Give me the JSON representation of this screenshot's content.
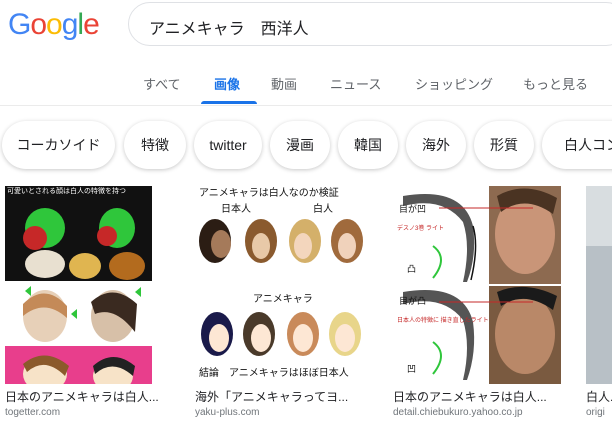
{
  "logo": {
    "letters": [
      "G",
      "o",
      "o",
      "g",
      "l",
      "e"
    ],
    "colors": [
      "#4285F4",
      "#EA4335",
      "#FBBC05",
      "#4285F4",
      "#34A853",
      "#EA4335"
    ]
  },
  "search": {
    "query": "アニメキャラ　西洋人"
  },
  "tabs": [
    {
      "label": "すべて"
    },
    {
      "label": "画像"
    },
    {
      "label": "動画"
    },
    {
      "label": "ニュース"
    },
    {
      "label": "ショッピング"
    },
    {
      "label": "もっと見る"
    }
  ],
  "chips": [
    "コーカソイド",
    "特徴",
    "twitter",
    "漫画",
    "韓国",
    "海外",
    "形質",
    "白人コン"
  ],
  "results": [
    {
      "caption": "日本のアニメキャラは白人...",
      "source": "togetter.com",
      "thumb_text": "可愛いとされる顔は白人の特徴を持つ"
    },
    {
      "caption": "海外「アニメキャラってヨ...",
      "source": "yaku-plus.com",
      "thumb_title": "アニメキャラは白人なのか検証",
      "label_japanese": "日本人",
      "label_white": "白人",
      "label_anime": "アニメキャラ",
      "label_conclusion": "結論　アニメキャラはほぼ日本人"
    },
    {
      "caption": "日本のアニメキャラは白人...",
      "source": "detail.chiebukuro.yahoo.co.jp",
      "label_1": "目が凹",
      "label_2": "目が凸",
      "note_1": "デスノ3巻 ライト",
      "note_2": "日本人の特徴に 描き直したライト",
      "label_convex": "凸",
      "label_concave": "凹"
    },
    {
      "caption": "白人...",
      "source": "origi"
    }
  ],
  "colors": {
    "accent": "#1a73e8",
    "muted": "#5f6368"
  }
}
